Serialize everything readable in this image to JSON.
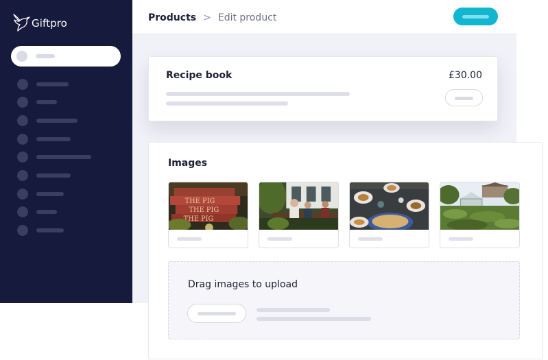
{
  "app": {
    "name": "Giftpro"
  },
  "breadcrumb": {
    "parent": "Products",
    "separator": ">",
    "current": "Edit product"
  },
  "product": {
    "name": "Recipe book",
    "price": "£30.00"
  },
  "images": {
    "title": "Images",
    "items": [
      {
        "photo": "books-the-pig-photo"
      },
      {
        "photo": "outdoor-dining-photo"
      },
      {
        "photo": "table-food-photo"
      },
      {
        "photo": "garden-greenhouse-photo"
      }
    ]
  },
  "upload": {
    "title": "Drag images to upload"
  },
  "colors": {
    "sidebar": "#161b3d",
    "accent": "#12b6cf",
    "content_bg": "#f1f1f8",
    "placeholder": "#dedfe8"
  }
}
